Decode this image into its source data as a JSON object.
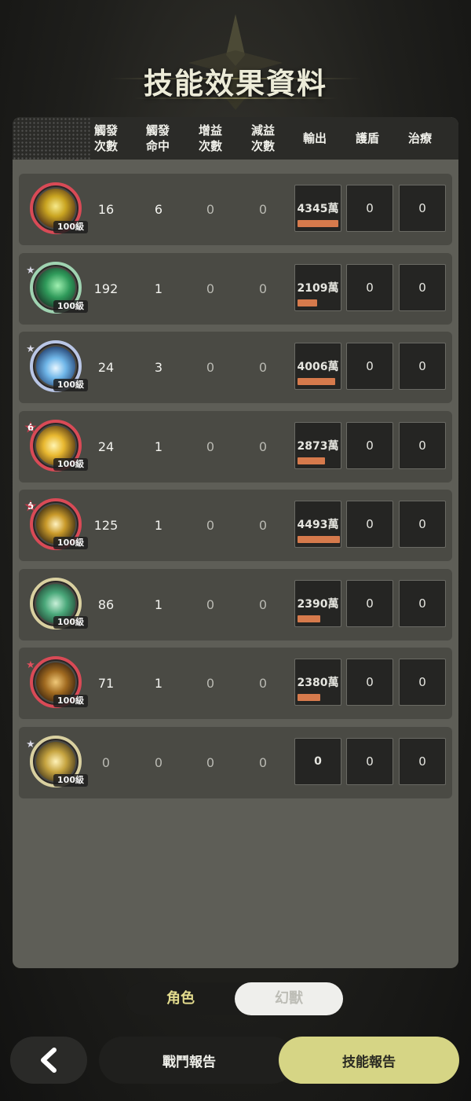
{
  "title": "技能效果資料",
  "headers": [
    "觸發\n次數",
    "觸發\n命中",
    "增益\n次數",
    "減益\n次數",
    "輸出",
    "護盾",
    "治療"
  ],
  "level_label": "100級",
  "rows": [
    {
      "icon": "lightning-skill-icon",
      "ring": "red",
      "badge": "",
      "triggers": "16",
      "hits": "6",
      "buffs": "0",
      "debuffs": "0",
      "output": "4345萬",
      "output_pct": 0.97,
      "shield": "0",
      "heal": "0"
    },
    {
      "icon": "wind-skill-icon",
      "ring": "green",
      "badge": "star",
      "triggers": "192",
      "hits": "1",
      "buffs": "0",
      "debuffs": "0",
      "output": "2109萬",
      "output_pct": 0.47,
      "shield": "0",
      "heal": "0"
    },
    {
      "icon": "ice-burst-skill-icon",
      "ring": "blue",
      "badge": "star",
      "triggers": "24",
      "hits": "3",
      "buffs": "0",
      "debuffs": "0",
      "output": "4006萬",
      "output_pct": 0.89,
      "shield": "0",
      "heal": "0"
    },
    {
      "icon": "light-burst-skill-icon",
      "ring": "red",
      "badge": "6",
      "triggers": "24",
      "hits": "1",
      "buffs": "0",
      "debuffs": "0",
      "output": "2873萬",
      "output_pct": 0.64,
      "shield": "0",
      "heal": "0"
    },
    {
      "icon": "golden-orb-skill-icon",
      "ring": "red",
      "badge": "5",
      "triggers": "125",
      "hits": "1",
      "buffs": "0",
      "debuffs": "0",
      "output": "4493萬",
      "output_pct": 1.0,
      "shield": "0",
      "heal": "0"
    },
    {
      "icon": "nature-orb-skill-icon",
      "ring": "rainbow",
      "badge": "",
      "triggers": "86",
      "hits": "1",
      "buffs": "0",
      "debuffs": "0",
      "output": "2390萬",
      "output_pct": 0.53,
      "shield": "0",
      "heal": "0"
    },
    {
      "icon": "sword-slash-skill-icon",
      "ring": "red",
      "badge": "star-red",
      "triggers": "71",
      "hits": "1",
      "buffs": "0",
      "debuffs": "0",
      "output": "2380萬",
      "output_pct": 0.53,
      "shield": "0",
      "heal": "0"
    },
    {
      "icon": "sacred-sigil-skill-icon",
      "ring": "rainbow",
      "badge": "star",
      "triggers": "0",
      "hits": "0",
      "buffs": "0",
      "debuffs": "0",
      "output": "0",
      "output_pct": 0,
      "shield": "0",
      "heal": "0"
    }
  ],
  "toggle": {
    "character": "角色",
    "phantom": "幻獸"
  },
  "bottom": {
    "battle_report": "戰鬥報告",
    "skill_report": "技能報告"
  },
  "colors": {
    "accent": "#d6d585",
    "output_bar": "#d67a4c",
    "panel": "#5e5e57"
  }
}
